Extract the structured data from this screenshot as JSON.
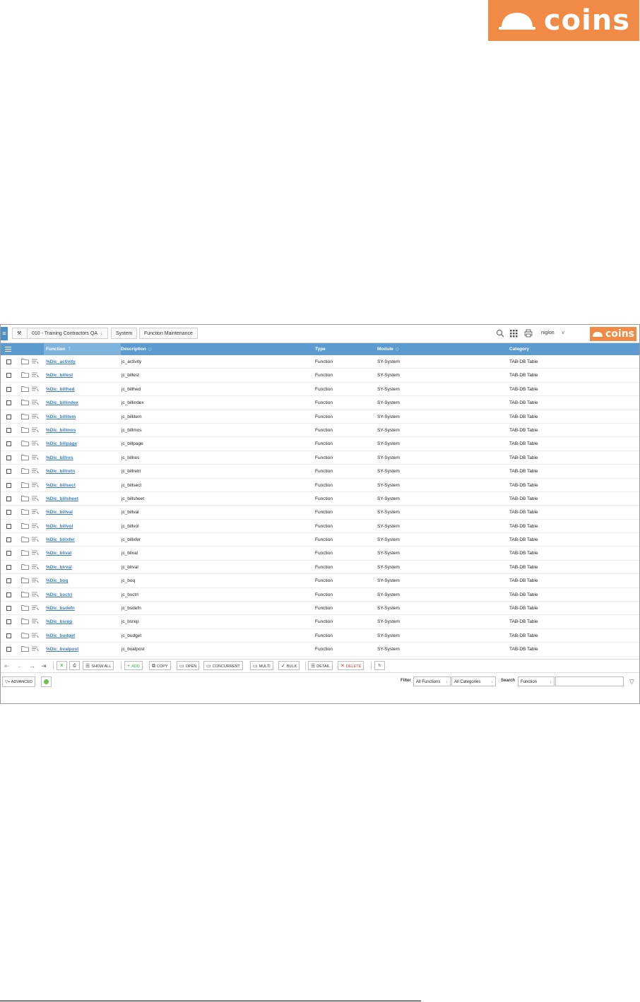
{
  "brand": {
    "name": "coins",
    "color": "#f08a45"
  },
  "topbar": {
    "breadcrumbs": [
      "010 - Training Contractors QA",
      "System",
      "Function Maintenance"
    ],
    "user": "niglon",
    "icons": [
      "hamburger-icon",
      "wrench-icon",
      "search-icon",
      "apps-grid-icon",
      "print-icon",
      "chevron-down-icon"
    ]
  },
  "grid": {
    "columns": [
      "Function",
      "Description",
      "Type",
      "Module",
      "Category"
    ],
    "sorted_column": "Function",
    "rows": [
      {
        "function": "%Dic_activity",
        "description": "jc_activity",
        "type": "Function",
        "module": "SY-System",
        "category": "TAB-DB Table"
      },
      {
        "function": "%Dic_billest",
        "description": "jc_billest",
        "type": "Function",
        "module": "SY-System",
        "category": "TAB-DB Table"
      },
      {
        "function": "%Dic_billhed",
        "description": "jc_billhed",
        "type": "Function",
        "module": "SY-System",
        "category": "TAB-DB Table"
      },
      {
        "function": "%Dic_billindex",
        "description": "jc_billindex",
        "type": "Function",
        "module": "SY-System",
        "category": "TAB-DB Table"
      },
      {
        "function": "%Dic_billitem",
        "description": "jc_billitem",
        "type": "Function",
        "module": "SY-System",
        "category": "TAB-DB Table"
      },
      {
        "function": "%Dic_billmos",
        "description": "jc_billmos",
        "type": "Function",
        "module": "SY-System",
        "category": "TAB-DB Table"
      },
      {
        "function": "%Dic_billpage",
        "description": "jc_billpage",
        "type": "Function",
        "module": "SY-System",
        "category": "TAB-DB Table"
      },
      {
        "function": "%Dic_billres",
        "description": "jc_billres",
        "type": "Function",
        "module": "SY-System",
        "category": "TAB-DB Table"
      },
      {
        "function": "%Dic_billretn",
        "description": "jc_billretn",
        "type": "Function",
        "module": "SY-System",
        "category": "TAB-DB Table"
      },
      {
        "function": "%Dic_billsect",
        "description": "jc_billsect",
        "type": "Function",
        "module": "SY-System",
        "category": "TAB-DB Table"
      },
      {
        "function": "%Dic_billsheet",
        "description": "jc_billsheet",
        "type": "Function",
        "module": "SY-System",
        "category": "TAB-DB Table"
      },
      {
        "function": "%Dic_billval",
        "description": "jc_billval",
        "type": "Function",
        "module": "SY-System",
        "category": "TAB-DB Table"
      },
      {
        "function": "%Dic_billvol",
        "description": "jc_billvol",
        "type": "Function",
        "module": "SY-System",
        "category": "TAB-DB Table"
      },
      {
        "function": "%Dic_billxfer",
        "description": "jc_billxfer",
        "type": "Function",
        "module": "SY-System",
        "category": "TAB-DB Table"
      },
      {
        "function": "%Dic_blival",
        "description": "jc_blival",
        "type": "Function",
        "module": "SY-System",
        "category": "TAB-DB Table"
      },
      {
        "function": "%Dic_blrval",
        "description": "jc_blrval",
        "type": "Function",
        "module": "SY-System",
        "category": "TAB-DB Table"
      },
      {
        "function": "%Dic_boq",
        "description": "jc_boq",
        "type": "Function",
        "module": "SY-System",
        "category": "TAB-DB Table"
      },
      {
        "function": "%Dic_bsctrl",
        "description": "jc_bsctrl",
        "type": "Function",
        "module": "SY-System",
        "category": "TAB-DB Table"
      },
      {
        "function": "%Dic_bsdefn",
        "description": "jc_bsdefn",
        "type": "Function",
        "module": "SY-System",
        "category": "TAB-DB Table"
      },
      {
        "function": "%Dic_bsrep",
        "description": "jc_bsrep",
        "type": "Function",
        "module": "SY-System",
        "category": "TAB-DB Table"
      },
      {
        "function": "%Dic_budget",
        "description": "jc_budget",
        "type": "Function",
        "module": "SY-System",
        "category": "TAB-DB Table"
      },
      {
        "function": "%Dic_bvalpost",
        "description": "jc_bvalpost",
        "type": "Function",
        "module": "SY-System",
        "category": "TAB-DB Table"
      }
    ]
  },
  "toolbar": {
    "show_all": "SHOW ALL",
    "add": "ADD",
    "copy": "COPY",
    "open": "OPEN",
    "concurrent": "CONCURRENT",
    "multi": "MULTI",
    "bulk": "BULK",
    "detail": "DETAIL",
    "delete": "DELETE"
  },
  "filterbar": {
    "advanced": "ADVANCED",
    "filter_label": "Filter",
    "filter_value": "All Functions",
    "category_value": "All Categories",
    "search_label": "Search",
    "search_field": "Function",
    "search_value": ""
  }
}
